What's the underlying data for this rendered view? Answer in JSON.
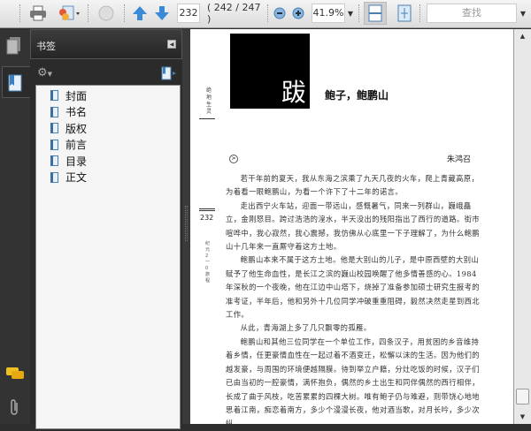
{
  "toolbar": {
    "page_input": "232",
    "page_count": "( 242 / 247 )",
    "zoom": "41.9%",
    "search_placeholder": "查找"
  },
  "panel": {
    "title": "书签",
    "bookmarks": [
      "封面",
      "书名",
      "版权",
      "前言",
      "目录",
      "正文"
    ]
  },
  "document": {
    "chapter_glyph": "跋",
    "title": "鲍子，鲍鹏山",
    "author": "朱鸿召",
    "running_head": "绝地生灵",
    "page_number": "232",
    "side_note": "纪元2一0旅程",
    "paragraphs": [
      "若干年前的夏天，我从东海之滨乘了九天几夜的火车，爬上青藏高原，为着看一眼鲍鹏山，为看一个许下了十二年的诺言。",
      "走出西宁火车站，迎面一带远山，感慨暑气，同来一列群山，巍峨矗立，金刚怒目。跨过浩浩的湟水，半天没出的残阳指出了西行的道路。街市喧哗中，我心寂然，我心震撼，我仿佛从心底里一下子理解了，为什么鲍鹏山十几年来一直厮守着这方土地。",
      "鲍鹏山本来不属于这方土地。他是大别山的儿子，是中原西壁的大别山赋予了他生命血性，是长江之滨的巍山校园唤醒了他多情善感的心。1984年深秋的一个夜晚，他在江边中山塔下，烧掉了准备参加硕士研究生报考的准考证，半年后，他和另外十几位同学冲破重重阻碍，毅然决然走星到西北工作。",
      "从此，青海湖上多了几只飘零的孤雁。",
      "鲍鹏山和其他三位同学在一个单位工作，四条汉子，用贫困的乡音维持着乡情，任更豪情血性在一起过着不酒变迁，松懈以沫的生活。因为他们的越发豪，与周围的环境便越隔膜。待到举立户籍，分灶吃饭的时候，汉子们已由当初的一腔豪情，满怀抱负，偶然的乡土出生和同伴偶然的西行相伴，长成了曲于风枝，吃苦累累的四棵大树。唯有鲍子仍与难避，则带饶心地地思着江南，痴恋着南方，多少个漫漫长夜，他对酒当歌，对月长吟，多少次纵"
    ]
  }
}
